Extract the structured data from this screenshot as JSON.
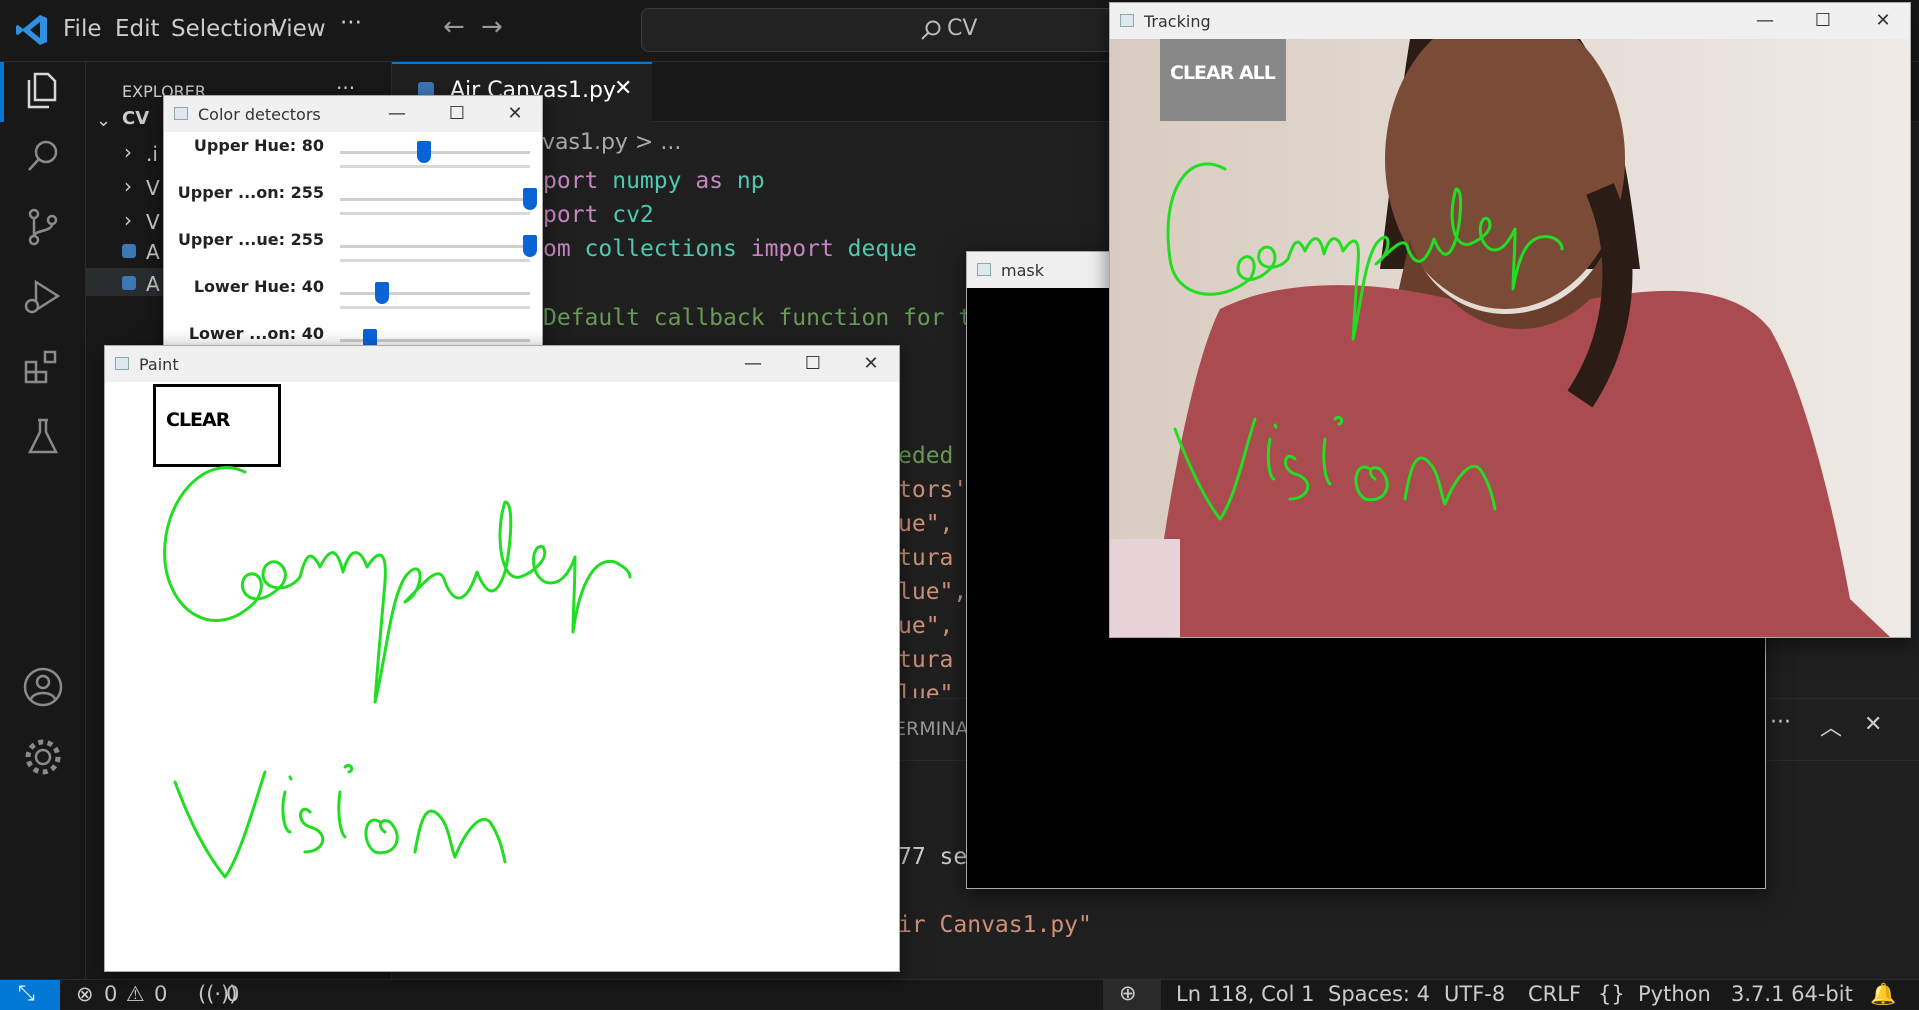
{
  "vscode": {
    "menu": [
      "File",
      "Edit",
      "Selection",
      "View",
      "···"
    ],
    "search_label": "CV",
    "sidebar": {
      "explorer_title": "EXPLORER",
      "explorer_more": "···",
      "root": "CV",
      "items": [
        ".i",
        "V",
        "V",
        "A",
        "A"
      ]
    },
    "tab": {
      "label": "Air Canvas1.py",
      "close": "✕"
    },
    "breadcrumb": "vas1.py > ...",
    "code_lines": [
      {
        "a": "port",
        "b": " numpy ",
        "c": "as",
        "d": " np"
      },
      {
        "a": "port",
        "b": " cv2",
        "c": "",
        "d": ""
      },
      {
        "a": "om",
        "b": " collections ",
        "c": "import",
        "d": " deque"
      }
    ],
    "comment": "Default callback function for t",
    "code_fragments": [
      "eded t",
      "tors'",
      "ue\", '",
      "tura",
      "lue\",",
      "ue\", '",
      "tura",
      "lue\""
    ],
    "panel": {
      "label": "ERMINA",
      "terminal_line1": "77 se",
      "terminal_line2": "ir Canvas1.py\""
    },
    "status": {
      "errors": "0",
      "warnings": "0",
      "ports": "0",
      "position": "Ln 118, Col 1",
      "spaces": "Spaces: 4",
      "encoding": "UTF-8",
      "eol": "CRLF",
      "lang_brackets": "{}",
      "language": "Python",
      "interpreter": "3.7.1 64-bit"
    }
  },
  "color_detectors": {
    "title": "Color detectors",
    "sliders": [
      {
        "label": "Upper Hue: 80",
        "value": 80,
        "max": 180
      },
      {
        "label": "Upper ...on: 255",
        "value": 255,
        "max": 255
      },
      {
        "label": "Upper ...ue: 255",
        "value": 255,
        "max": 255
      },
      {
        "label": "Lower Hue: 40",
        "value": 40,
        "max": 180
      },
      {
        "label": "Lower ...on: 40",
        "value": 40,
        "max": 255
      }
    ]
  },
  "paint": {
    "title": "Paint",
    "clear_label": "CLEAR",
    "ink_color": "#22dd22"
  },
  "mask": {
    "title": "mask"
  },
  "tracking": {
    "title": "Tracking",
    "clear_all_label": "CLEAR ALL"
  },
  "window_controls": {
    "min": "—",
    "max": "☐",
    "close": "✕"
  }
}
